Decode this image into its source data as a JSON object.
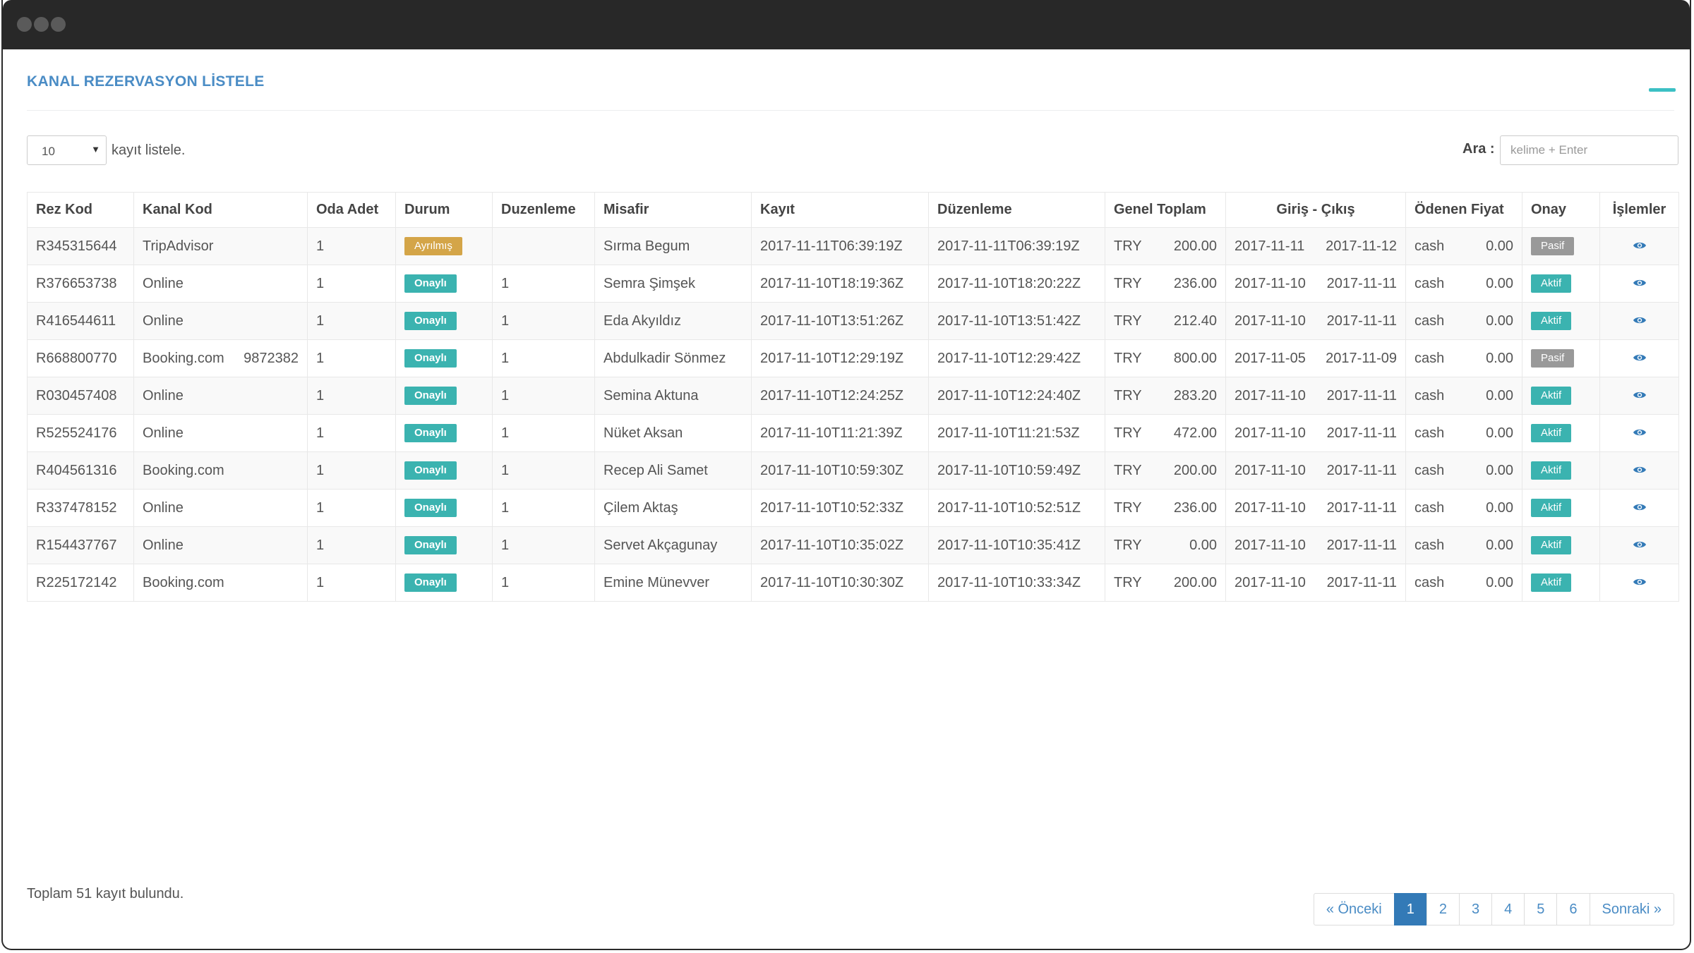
{
  "panel": {
    "title": "KANAL REZERVASYON LİSTELE"
  },
  "controls": {
    "page_size": "10",
    "page_size_label": "kayıt listele.",
    "search_label": "Ara :",
    "search_placeholder": "kelime + Enter"
  },
  "table": {
    "headers": [
      "Rez Kod",
      "Kanal Kod",
      "Oda Adet",
      "Durum",
      "Duzenleme",
      "Misafir",
      "Kayıt",
      "Düzenleme",
      "Genel Toplam",
      "Giriş - Çıkış",
      "Ödenen Fiyat",
      "Onay",
      "İşlemler"
    ],
    "rows": [
      {
        "rez": "R345315644",
        "kanal": "TripAdvisor",
        "kanal_no": "",
        "oda": "1",
        "durum": "Ayrılmış",
        "duzen": "",
        "misafir": "Sırma Begum",
        "kayit": "2017-11-11T06:39:19Z",
        "duzenleme": "2017-11-11T06:39:19Z",
        "cur": "TRY",
        "toplam": "200.00",
        "giris": "2017-11-11",
        "cikis": "2017-11-12",
        "odeme": "cash",
        "odenen": "0.00",
        "onay": "Pasif"
      },
      {
        "rez": "R376653738",
        "kanal": "Online",
        "kanal_no": "",
        "oda": "1",
        "durum": "Onaylı",
        "duzen": "1",
        "misafir": "Semra Şimşek",
        "kayit": "2017-11-10T18:19:36Z",
        "duzenleme": "2017-11-10T18:20:22Z",
        "cur": "TRY",
        "toplam": "236.00",
        "giris": "2017-11-10",
        "cikis": "2017-11-11",
        "odeme": "cash",
        "odenen": "0.00",
        "onay": "Aktif"
      },
      {
        "rez": "R416544611",
        "kanal": "Online",
        "kanal_no": "",
        "oda": "1",
        "durum": "Onaylı",
        "duzen": "1",
        "misafir": "Eda Akyıldız",
        "kayit": "2017-11-10T13:51:26Z",
        "duzenleme": "2017-11-10T13:51:42Z",
        "cur": "TRY",
        "toplam": "212.40",
        "giris": "2017-11-10",
        "cikis": "2017-11-11",
        "odeme": "cash",
        "odenen": "0.00",
        "onay": "Aktif"
      },
      {
        "rez": "R668800770",
        "kanal": "Booking.com",
        "kanal_no": "9872382",
        "oda": "1",
        "durum": "Onaylı",
        "duzen": "1",
        "misafir": "Abdulkadir Sönmez",
        "kayit": "2017-11-10T12:29:19Z",
        "duzenleme": "2017-11-10T12:29:42Z",
        "cur": "TRY",
        "toplam": "800.00",
        "giris": "2017-11-05",
        "cikis": "2017-11-09",
        "odeme": "cash",
        "odenen": "0.00",
        "onay": "Pasif"
      },
      {
        "rez": "R030457408",
        "kanal": "Online",
        "kanal_no": "",
        "oda": "1",
        "durum": "Onaylı",
        "duzen": "1",
        "misafir": "Semina Aktuna",
        "kayit": "2017-11-10T12:24:25Z",
        "duzenleme": "2017-11-10T12:24:40Z",
        "cur": "TRY",
        "toplam": "283.20",
        "giris": "2017-11-10",
        "cikis": "2017-11-11",
        "odeme": "cash",
        "odenen": "0.00",
        "onay": "Aktif"
      },
      {
        "rez": "R525524176",
        "kanal": "Online",
        "kanal_no": "",
        "oda": "1",
        "durum": "Onaylı",
        "duzen": "1",
        "misafir": "Nüket Aksan",
        "kayit": "2017-11-10T11:21:39Z",
        "duzenleme": "2017-11-10T11:21:53Z",
        "cur": "TRY",
        "toplam": "472.00",
        "giris": "2017-11-10",
        "cikis": "2017-11-11",
        "odeme": "cash",
        "odenen": "0.00",
        "onay": "Aktif"
      },
      {
        "rez": "R404561316",
        "kanal": "Booking.com",
        "kanal_no": "",
        "oda": "1",
        "durum": "Onaylı",
        "duzen": "1",
        "misafir": "Recep Ali Samet",
        "kayit": "2017-11-10T10:59:30Z",
        "duzenleme": "2017-11-10T10:59:49Z",
        "cur": "TRY",
        "toplam": "200.00",
        "giris": "2017-11-10",
        "cikis": "2017-11-11",
        "odeme": "cash",
        "odenen": "0.00",
        "onay": "Aktif"
      },
      {
        "rez": "R337478152",
        "kanal": "Online",
        "kanal_no": "",
        "oda": "1",
        "durum": "Onaylı",
        "duzen": "1",
        "misafir": "Çilem Aktaş",
        "kayit": "2017-11-10T10:52:33Z",
        "duzenleme": "2017-11-10T10:52:51Z",
        "cur": "TRY",
        "toplam": "236.00",
        "giris": "2017-11-10",
        "cikis": "2017-11-11",
        "odeme": "cash",
        "odenen": "0.00",
        "onay": "Aktif"
      },
      {
        "rez": "R154437767",
        "kanal": "Online",
        "kanal_no": "",
        "oda": "1",
        "durum": "Onaylı",
        "duzen": "1",
        "misafir": "Servet Akçagunay",
        "kayit": "2017-11-10T10:35:02Z",
        "duzenleme": "2017-11-10T10:35:41Z",
        "cur": "TRY",
        "toplam": "0.00",
        "giris": "2017-11-10",
        "cikis": "2017-11-11",
        "odeme": "cash",
        "odenen": "0.00",
        "onay": "Aktif"
      },
      {
        "rez": "R225172142",
        "kanal": "Booking.com",
        "kanal_no": "",
        "oda": "1",
        "durum": "Onaylı",
        "duzen": "1",
        "misafir": "Emine Münevver",
        "kayit": "2017-11-10T10:30:30Z",
        "duzenleme": "2017-11-10T10:33:34Z",
        "cur": "TRY",
        "toplam": "200.00",
        "giris": "2017-11-10",
        "cikis": "2017-11-11",
        "odeme": "cash",
        "odenen": "0.00",
        "onay": "Aktif"
      }
    ],
    "action_icon": "eye-icon"
  },
  "footer": {
    "total_text": "Toplam 51 kayıt bulundu.",
    "pagination": {
      "prev": "« Önceki",
      "pages": [
        "1",
        "2",
        "3",
        "4",
        "5",
        "6"
      ],
      "active": "1",
      "next": "Sonraki »"
    }
  },
  "colors": {
    "title": "#4a8cc5",
    "badge_onayli": "#3bb3b0",
    "badge_ayrilmis": "#d4a548",
    "badge_aktif": "#3bb3b0",
    "badge_pasif": "#999999",
    "pagination_active": "#337ab7"
  }
}
